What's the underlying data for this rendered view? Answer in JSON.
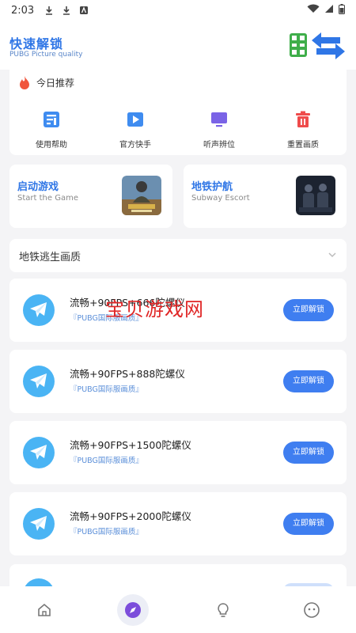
{
  "status_bar": {
    "time": "2:03"
  },
  "header": {
    "title": "快速解锁",
    "subtitle": "PUBG Picture quality"
  },
  "recommend": {
    "title": "今日推荐",
    "items": [
      {
        "label": "使用帮助",
        "icon": "document-icon",
        "color": "#3f8cf0"
      },
      {
        "label": "官方快手",
        "icon": "play-icon",
        "color": "#3f8cf0"
      },
      {
        "label": "听声辨位",
        "icon": "monitor-icon",
        "color": "#7a63e6"
      },
      {
        "label": "重置画质",
        "icon": "trash-icon",
        "color": "#ef4b4b"
      }
    ]
  },
  "features": [
    {
      "title": "启动游戏",
      "subtitle": "Start the Game"
    },
    {
      "title": "地铁护航",
      "subtitle": "Subway Escort"
    }
  ],
  "selector": {
    "label": "地铁逃生画质"
  },
  "options": [
    {
      "name": "流畅+90FPS+666陀螺仪",
      "tag": "『PUBG国际服画质』",
      "button": "立即解锁"
    },
    {
      "name": "流畅+90FPS+888陀螺仪",
      "tag": "『PUBG国际服画质』",
      "button": "立即解锁"
    },
    {
      "name": "流畅+90FPS+1500陀螺仪",
      "tag": "『PUBG国际服画质』",
      "button": "立即解锁"
    },
    {
      "name": "流畅+90FPS+2000陀螺仪",
      "tag": "『PUBG国际服画质』",
      "button": "立即解锁"
    }
  ],
  "watermark": "宝贝游戏网",
  "colors": {
    "accent": "#2f76e6",
    "button": "#3f7ef0",
    "avatar": "#4ab4f4",
    "active_tab": "#7c4ddb"
  }
}
